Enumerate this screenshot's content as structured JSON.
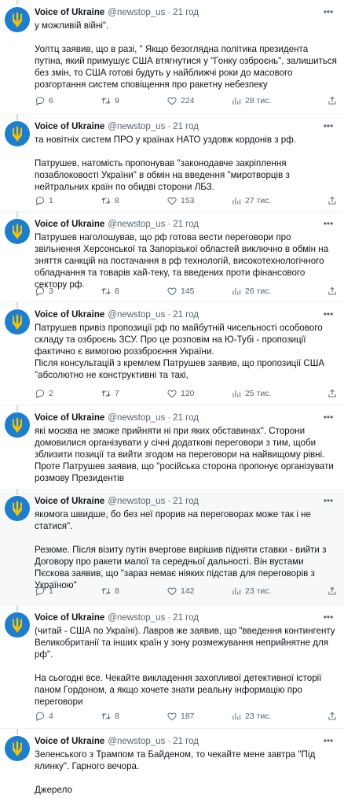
{
  "account": {
    "name": "Voice of Ukraine",
    "handle": "@newstop_us",
    "separator": "·"
  },
  "tweets": [
    {
      "time": "21 год",
      "paragraphs": [
        "у можливій війні\".",
        "Уолтц заявив, що в разі, \" Якщо безоглядна політика президента путіна, який примушує США втягнутися у \"Гонку озброєнь\", залишиться без змін, то США готові будуть у найближчі роки до масового розгортання систем сповіщення про ракетну небезпеку"
      ],
      "replies": "6",
      "retweets": "9",
      "likes": "224",
      "views": "28 тис."
    },
    {
      "time": "21 год",
      "paragraphs": [
        "та новітніх систем ПРО у країнах НАТО уздовж кордонів з рф.",
        "Патрушев, натомість пропонував \"законодавче закріплення позаблоковості України\" в обмін на введення \"миротворців з нейтральних країн по обидві сторони ЛБЗ."
      ],
      "replies": "1",
      "retweets": "8",
      "likes": "153",
      "views": "27 тис."
    },
    {
      "time": "21 год",
      "paragraphs": [
        "Патрушев наголошував, що рф готова вести переговори про звільнення Херсонської та Запорізької областей виключно в обмін на зняття санкцій на постачання в рф технологій, високотехнологічного обладнання та товарів хай-теку, та введених проти фінансового сектору рф."
      ],
      "replies": "3",
      "retweets": "8",
      "likes": "145",
      "views": "26 тис."
    },
    {
      "time": "21 год",
      "paragraphs": [
        "Патрушев привіз пропозиції рф по майбутній чисельності особового складу та озброєнь ЗСУ. Про це розповім на Ю-Тубі -  пропозиції фактично є вимогою роззброєння України.",
        "Після консультацій з кремлем Патрушев заявив, що пропозиції США \"абсолютно не конструктивні та такі,"
      ],
      "replies": "2",
      "retweets": "7",
      "likes": "120",
      "views": "25 тис."
    },
    {
      "time": "21 год",
      "paragraphs": [
        "які москва не зможе прийняти ні при яких обставинах\". Сторони домовилися організувати у січні додаткові переговори з тим, щоби зблизити позиції та вийти згодом на переговори на найвищому рівні. Проте Патрушев заявив, що \"російська сторона пропонує організувати розмову Президентів"
      ],
      "replies": "",
      "retweets": "",
      "likes": "",
      "views": ""
    },
    {
      "time": "21 год",
      "paragraphs": [
        "якомога швидше, бо без неї прорив на переговорах може так і не статися\".",
        "Резюме. Після візиту путін вчергове вирішив підняти ставки - вийти з Договору про ракети малої та середньої дальності. Він вустами Пєскова заявив, що \"зараз немає ніяких підстав для переговорів з Україною\""
      ],
      "replies": "1",
      "retweets": "8",
      "likes": "142",
      "views": "23 тис."
    },
    {
      "time": "21 год",
      "paragraphs": [
        "(читай - США по Україні). Лавров же заявив, що \"введення контингенту Великобританії та інших країн у зону розмежування неприйнятне для рф\".",
        "На сьогодні все. Чекайте викладення захопливої детективної історії паном Гордоном, а якщо хочете знати реальну інформацію про переговори"
      ],
      "replies": "4",
      "retweets": "8",
      "likes": "187",
      "views": "23 тис."
    },
    {
      "time": "21 год",
      "paragraphs": [
        "Зеленського з Трампом та Байденом, то чекайте мене завтра \"Під ялинку\". Гарного вечора.",
        "Джерело"
      ],
      "replies": "",
      "retweets": "",
      "likes": "",
      "views": ""
    }
  ],
  "icons": {
    "avatar": "ukraine-trident",
    "more": "more-dots-icon",
    "reply": "reply-icon",
    "retweet": "retweet-icon",
    "like": "heart-icon",
    "views": "views-icon",
    "share": "share-icon"
  },
  "colors": {
    "avatar_bg": "#1d7ed0",
    "trident": "#f5c400",
    "muted": "#536471",
    "text": "#0f1419",
    "highlight_bg": "#f7f9f9"
  }
}
